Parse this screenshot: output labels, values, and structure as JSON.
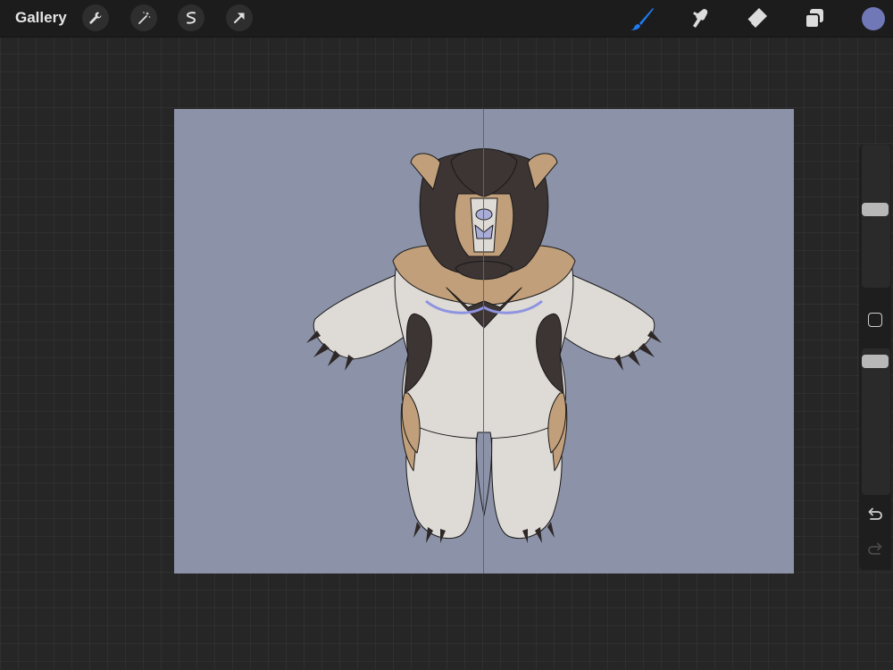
{
  "topbar": {
    "gallery_label": "Gallery",
    "left_tools": [
      "wrench-icon",
      "magic-wand-icon",
      "selection-icon",
      "transform-arrow-icon"
    ],
    "right_tools": [
      "brush-icon",
      "smudge-icon",
      "eraser-icon",
      "layers-icon"
    ],
    "active_tool": "brush",
    "active_tool_color": "#1e7cf2",
    "current_color": "#7078b8"
  },
  "canvas": {
    "background_color": "#8c93a8",
    "symmetry_guide": "vertical",
    "artwork": "character-reference"
  },
  "sidebar": {
    "brush_size": 0.55,
    "opacity": 0.95,
    "icons": [
      "modify-button",
      "undo-icon",
      "redo-icon"
    ]
  }
}
